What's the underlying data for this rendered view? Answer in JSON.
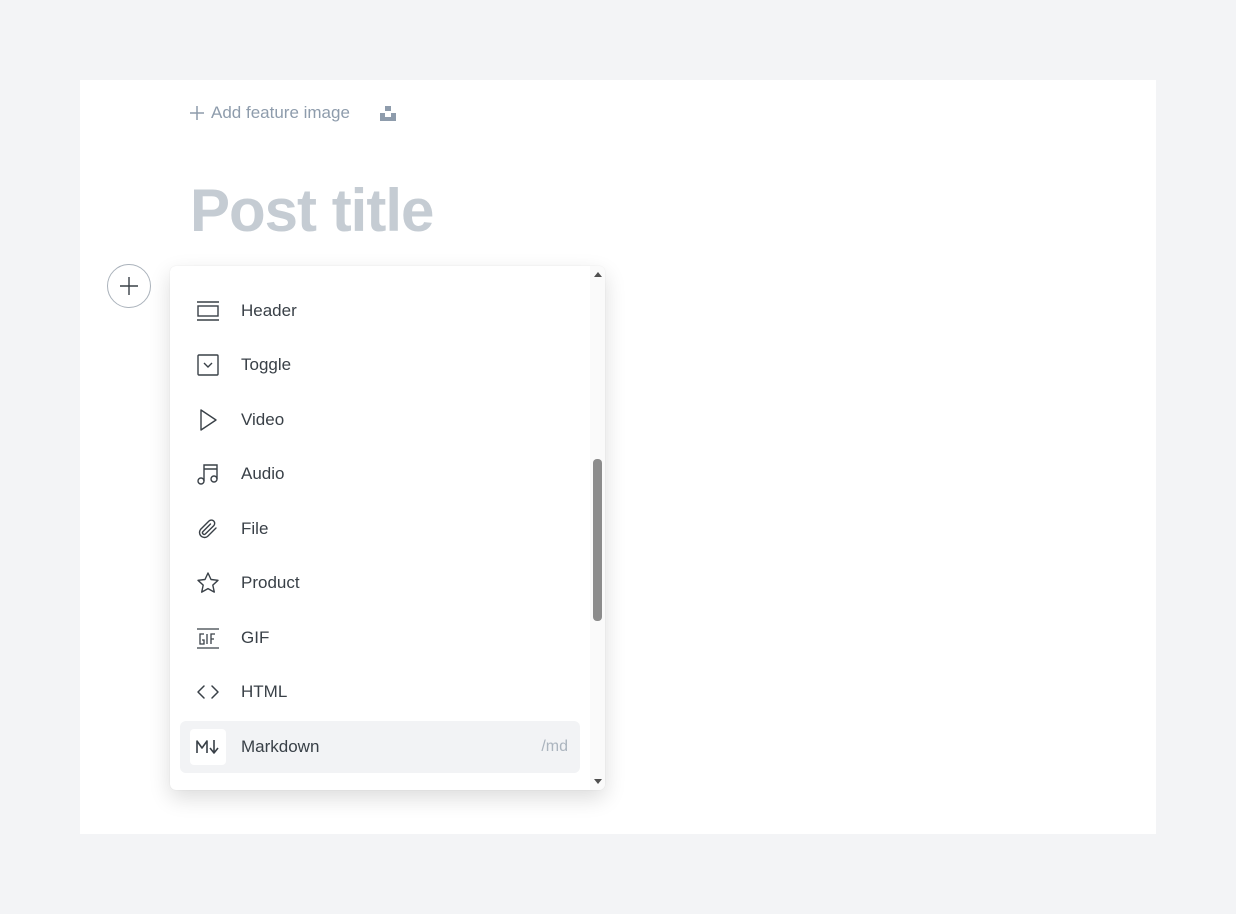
{
  "editor": {
    "add_feature_image_label": "Add feature image",
    "title_placeholder": "Post title"
  },
  "card_menu": {
    "items": [
      {
        "label": "Header",
        "icon": "header-icon"
      },
      {
        "label": "Toggle",
        "icon": "toggle-icon"
      },
      {
        "label": "Video",
        "icon": "video-icon"
      },
      {
        "label": "Audio",
        "icon": "audio-icon"
      },
      {
        "label": "File",
        "icon": "file-icon"
      },
      {
        "label": "Product",
        "icon": "product-icon"
      },
      {
        "label": "GIF",
        "icon": "gif-icon"
      },
      {
        "label": "HTML",
        "icon": "html-icon"
      },
      {
        "label": "Markdown",
        "icon": "markdown-icon",
        "shortcut": "/md",
        "selected": true
      }
    ]
  },
  "colors": {
    "background": "#f3f4f6",
    "text": "#394047",
    "muted": "#8e9cac",
    "title_placeholder": "#c5ccd3",
    "selected_bg": "#f2f3f5"
  }
}
